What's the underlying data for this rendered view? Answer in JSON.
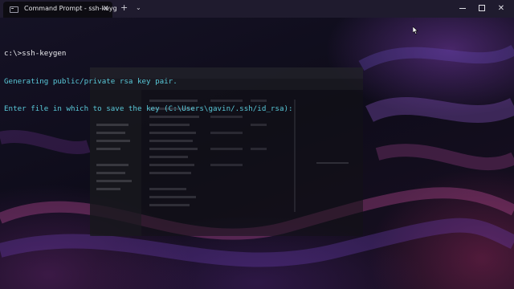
{
  "window": {
    "tab_title": "Command Prompt - ssh-keyg",
    "tab_icon": "terminal-icon",
    "close_tab_glyph": "✕",
    "new_tab_glyph": "+",
    "dropdown_glyph": "⌄",
    "close_window_glyph": "✕"
  },
  "terminal": {
    "lines": [
      "c:\\>ssh-keygen",
      "Generating public/private rsa key pair.",
      "Enter file in which to save the key (C:\\Users\\gavin/.ssh/id_rsa):"
    ]
  },
  "colors": {
    "terminal_output": "#59c8d8",
    "terminal_command": "#e8e8ec",
    "titlebar": "#1f1b2e",
    "terminal_bg": "#0d0c12"
  }
}
